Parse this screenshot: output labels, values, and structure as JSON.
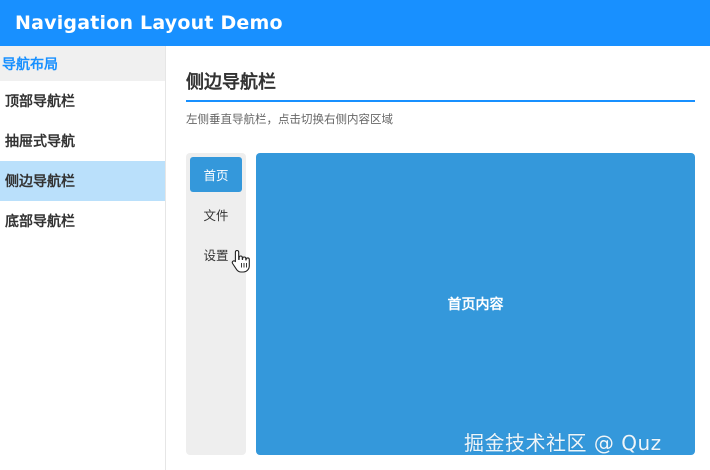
{
  "header": {
    "title": "Navigation Layout Demo",
    "background": "#1890ff"
  },
  "sidebar": {
    "header_label": "导航布局",
    "items": [
      {
        "label": "顶部导航栏",
        "active": false
      },
      {
        "label": "抽屉式导航",
        "active": false
      },
      {
        "label": "侧边导航栏",
        "active": true
      },
      {
        "label": "底部导航栏",
        "active": false
      }
    ]
  },
  "main": {
    "title": "侧边导航栏",
    "description": "左侧垂直导航栏，点击切换右侧内容区域",
    "vertical_nav": {
      "items": [
        {
          "label": "首页",
          "active": true
        },
        {
          "label": "文件",
          "active": false
        },
        {
          "label": "设置",
          "active": false
        }
      ]
    },
    "content": {
      "text": "首页内容",
      "background": "#3498db"
    }
  },
  "watermark": "掘金技术社区 @ Quz",
  "colors": {
    "accent": "#1890ff",
    "active_sidebar_bg": "#bae0fb",
    "panel_blue": "#3498db"
  },
  "icons": {
    "cursor": "hand-pointer-icon"
  }
}
